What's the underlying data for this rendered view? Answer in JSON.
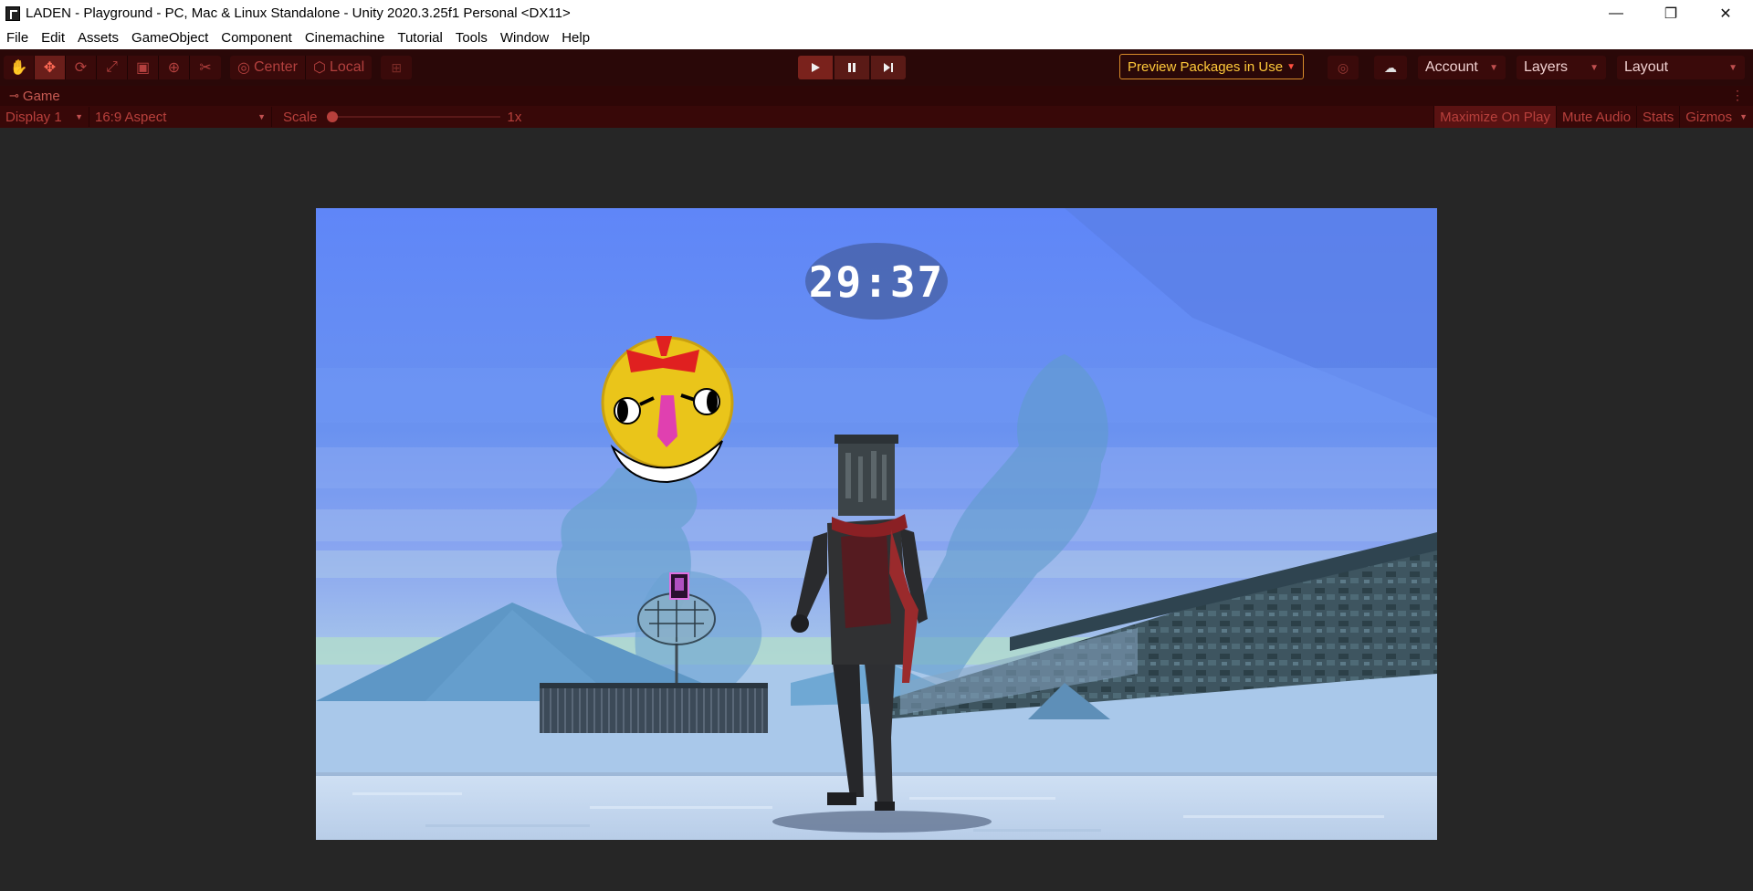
{
  "window": {
    "title": "LADEN - Playground - PC, Mac & Linux Standalone - Unity 2020.3.25f1 Personal <DX11>",
    "minimize": "—",
    "maximize": "❐",
    "close": "✕"
  },
  "menu": {
    "items": [
      "File",
      "Edit",
      "Assets",
      "GameObject",
      "Component",
      "Cinemachine",
      "Tutorial",
      "Tools",
      "Window",
      "Help"
    ]
  },
  "toolbar": {
    "tools": [
      {
        "name": "hand-tool",
        "glyph": "✋",
        "active": false
      },
      {
        "name": "move-tool",
        "glyph": "✥",
        "active": true
      },
      {
        "name": "rotate-tool",
        "glyph": "⟳",
        "active": false
      },
      {
        "name": "scale-tool",
        "glyph": "⤢",
        "active": false
      },
      {
        "name": "rect-tool",
        "glyph": "▣",
        "active": false
      },
      {
        "name": "transform-tool",
        "glyph": "⊕",
        "active": false
      },
      {
        "name": "custom-tool",
        "glyph": "✂",
        "active": false
      }
    ],
    "pivot_mode": "Center",
    "pivot_rotation": "Local",
    "preview_packages": "Preview Packages in Use",
    "account": "Account",
    "layers": "Layers",
    "layout": "Layout",
    "accent_color": "#ffc93a"
  },
  "game_tab": {
    "label": "Game"
  },
  "game_bar": {
    "display": "Display 1",
    "aspect": "16:9 Aspect",
    "scale_label": "Scale",
    "scale_value": "1x",
    "maximize_on_play": "Maximize On Play",
    "mute_audio": "Mute Audio",
    "stats": "Stats",
    "gizmos": "Gizmos"
  },
  "game": {
    "timer": "29:37"
  }
}
